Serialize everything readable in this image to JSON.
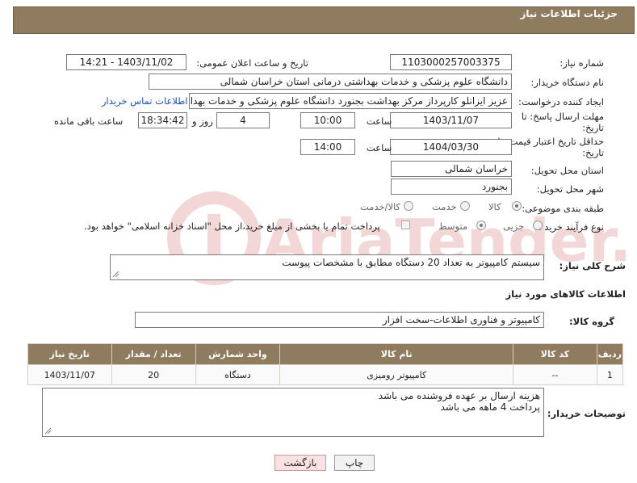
{
  "header": {
    "title": "جزئیات اطلاعات نیاز"
  },
  "fields": {
    "need_number_label": "شماره نیاز:",
    "need_number": "1103000257003375",
    "announce_label": "تاریخ و ساعت اعلان عمومی:",
    "announce_value": "1403/11/02 - 14:21",
    "buyer_org_label": "نام دستگاه خریدار:",
    "buyer_org": "دانشگاه علوم پزشکی و خدمات بهداشتی درمانی استان خراسان شمالی",
    "requester_label": "ایجاد کننده درخواست:",
    "requester": "عزیز ایزانلو کارپرداز مرکز بهداشت بجنورد دانشگاه علوم پزشکی و خدمات بهداشتی",
    "contact_link": "اطلاعات تماس خریدار",
    "reply_deadline_label_1": "مهلت ارسال پاسخ: تا",
    "reply_deadline_label_2": "تاریخ:",
    "reply_date": "1403/11/07",
    "time_label": "ساعت",
    "reply_time": "10:00",
    "days_value": "4",
    "days_label": "روز و",
    "remaining_time": "18:34:42",
    "remaining_label": "ساعت باقی مانده",
    "validity_label_1": "حداقل تاریخ اعتبار قیمت: تا",
    "validity_label_2": "تاریخ:",
    "validity_date": "1404/03/30",
    "validity_time": "14:00",
    "province_label": "استان محل تحویل:",
    "province": "خراسان شمالی",
    "city_label": "شهر محل تحویل:",
    "city": "بجنورد",
    "category_label": "طبقه بندی موضوعی:",
    "category_options": [
      "کالا",
      "خدمت",
      "کالا/خدمت"
    ],
    "process_label": "نوع فرآیند خرید :",
    "process_options": [
      "جزیی",
      "متوسط"
    ],
    "payment_note": "پرداخت تمام یا بخشی از مبلغ خرید،از محل \"اسناد خزانه اسلامی\" خواهد بود."
  },
  "description": {
    "label": "شرح کلی نیاز:",
    "value": "سیستم کامپیوتر به تعداد 20 دستگاه مطابق با مشخصات پیوست"
  },
  "goods_section": {
    "title": "اطلاعات کالاهای مورد نیاز",
    "group_label": "گروه کالا:",
    "group_value": "کامپیوتر و فناوری اطلاعات-سخت افزار"
  },
  "table": {
    "headers": [
      "ردیف",
      "کد کالا",
      "نام کالا",
      "واحد شمارش",
      "تعداد / مقدار",
      "تاریخ نیاز"
    ],
    "rows": [
      [
        "1",
        "--",
        "کامپیوتر رومیزی",
        "دستگاه",
        "20",
        "1403/11/07"
      ]
    ]
  },
  "buyer_notes": {
    "label": "توضیحات خریدار:",
    "line1": "هزینه ارسال بر عهده فروشنده می باشد",
    "line2": "پرداخت 4 ماهه می باشد"
  },
  "buttons": {
    "print": "چاپ",
    "back": "بازگشت"
  },
  "watermark": "AriaTender.neT",
  "colors": {
    "header_bg": "#8f7b5e",
    "link": "#1c4fc0",
    "watermark": "#f3d6d6"
  }
}
